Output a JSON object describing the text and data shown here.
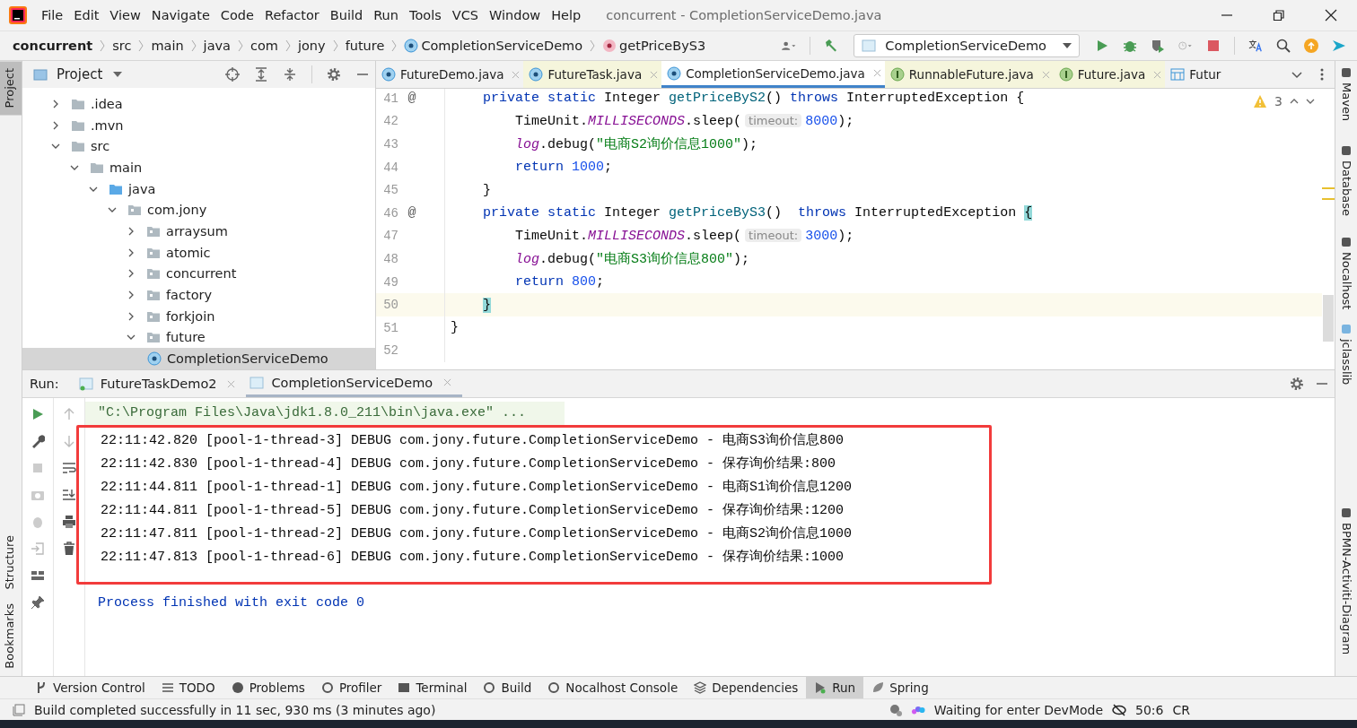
{
  "menu_bar": {
    "items": [
      "File",
      "Edit",
      "View",
      "Navigate",
      "Code",
      "Refactor",
      "Build",
      "Run",
      "Tools",
      "VCS",
      "Window",
      "Help"
    ],
    "title": "concurrent - CompletionServiceDemo.java"
  },
  "breadcrumb": [
    {
      "label": "concurrent",
      "kind": "project"
    },
    {
      "label": "src",
      "kind": "folder"
    },
    {
      "label": "main",
      "kind": "folder"
    },
    {
      "label": "java",
      "kind": "folder"
    },
    {
      "label": "com",
      "kind": "folder"
    },
    {
      "label": "jony",
      "kind": "folder"
    },
    {
      "label": "future",
      "kind": "folder"
    },
    {
      "label": "CompletionServiceDemo",
      "kind": "class"
    },
    {
      "label": "getPriceByS3",
      "kind": "method"
    }
  ],
  "run_config": {
    "label": "CompletionServiceDemo"
  },
  "left_strip_top": [
    {
      "label": "Project",
      "selected": true
    }
  ],
  "left_strip_bottom": [
    {
      "label": "Structure",
      "selected": false
    },
    {
      "label": "Bookmarks",
      "selected": false
    }
  ],
  "right_strip": [
    {
      "label": "Maven",
      "kind": "maven"
    },
    {
      "label": "Database",
      "kind": "database"
    },
    {
      "label": "Nocalhost",
      "kind": "nocalhost"
    },
    {
      "label": "jclasslib",
      "kind": "jclasslib"
    },
    {
      "label": "BPMN-Activiti-Diagram",
      "kind": "bpmn"
    }
  ],
  "project_panel": {
    "title": "Project",
    "tree": [
      {
        "label": ".idea",
        "kind": "folder",
        "expanded": false,
        "selected": false
      },
      {
        "label": ".mvn",
        "kind": "folder",
        "expanded": false,
        "selected": false
      },
      {
        "label": "src",
        "kind": "folder",
        "expanded": true,
        "selected": false,
        "children": [
          {
            "label": "main",
            "kind": "folder",
            "expanded": true,
            "selected": false,
            "children": [
              {
                "label": "java",
                "kind": "source",
                "expanded": true,
                "selected": false,
                "children": [
                  {
                    "label": "com.jony",
                    "kind": "package",
                    "expanded": true,
                    "selected": false,
                    "children": [
                      {
                        "label": "arraysum",
                        "kind": "package",
                        "expanded": false,
                        "selected": false
                      },
                      {
                        "label": "atomic",
                        "kind": "package",
                        "expanded": false,
                        "selected": false
                      },
                      {
                        "label": "concurrent",
                        "kind": "package",
                        "expanded": false,
                        "selected": false
                      },
                      {
                        "label": "factory",
                        "kind": "package",
                        "expanded": false,
                        "selected": false
                      },
                      {
                        "label": "forkjoin",
                        "kind": "package",
                        "expanded": false,
                        "selected": false
                      },
                      {
                        "label": "future",
                        "kind": "package",
                        "expanded": true,
                        "selected": false,
                        "children": [
                          {
                            "label": "CompletionServiceDemo",
                            "kind": "class",
                            "selected": true
                          }
                        ]
                      }
                    ]
                  }
                ]
              }
            ]
          }
        ]
      }
    ]
  },
  "editor_tabs": [
    {
      "label": "FutureDemo.java",
      "kind": "class",
      "library": false,
      "selected": false,
      "closable": true
    },
    {
      "label": "FutureTask.java",
      "kind": "class",
      "library": true,
      "selected": false,
      "closable": true
    },
    {
      "label": "CompletionServiceDemo.java",
      "kind": "class",
      "library": false,
      "selected": true,
      "closable": true
    },
    {
      "label": "RunnableFuture.java",
      "kind": "interface",
      "library": true,
      "selected": false,
      "closable": true
    },
    {
      "label": "Future.java",
      "kind": "interface",
      "library": true,
      "selected": false,
      "closable": true
    },
    {
      "label": "Futur",
      "kind": "diagram",
      "library": false,
      "selected": false,
      "closable": false
    }
  ],
  "editor": {
    "warnings": "3",
    "lines": [
      {
        "number": "41",
        "marker": "@",
        "current": false,
        "tokens": [
          {
            "text": "    private static ",
            "kind": "keyword"
          },
          {
            "text": "Integer ",
            "kind": "plain"
          },
          {
            "text": "getPriceByS2",
            "kind": "method"
          },
          {
            "text": "() ",
            "kind": "plain"
          },
          {
            "text": "throws ",
            "kind": "keyword"
          },
          {
            "text": "InterruptedException {",
            "kind": "plain"
          }
        ]
      },
      {
        "number": "42",
        "current": false,
        "tokens": [
          {
            "text": "        TimeUnit.",
            "kind": "plain"
          },
          {
            "text": "MILLISECONDS",
            "kind": "field"
          },
          {
            "text": ".sleep(",
            "kind": "plain"
          },
          {
            "text": "timeout:",
            "kind": "hint"
          },
          {
            "text": "8000",
            "kind": "number"
          },
          {
            "text": ");",
            "kind": "plain"
          }
        ]
      },
      {
        "number": "43",
        "current": false,
        "tokens": [
          {
            "text": "        log",
            "kind": "field"
          },
          {
            "text": ".debug(",
            "kind": "plain"
          },
          {
            "text": "\"电商S2询价信息1000\"",
            "kind": "string"
          },
          {
            "text": ");",
            "kind": "plain"
          }
        ]
      },
      {
        "number": "44",
        "current": false,
        "tokens": [
          {
            "text": "        return ",
            "kind": "keyword"
          },
          {
            "text": "1000",
            "kind": "number"
          },
          {
            "text": ";",
            "kind": "plain"
          }
        ]
      },
      {
        "number": "45",
        "current": false,
        "tokens": [
          {
            "text": "    }",
            "kind": "plain"
          }
        ]
      },
      {
        "number": "46",
        "marker": "@",
        "current": false,
        "tokens": [
          {
            "text": "    private static ",
            "kind": "keyword"
          },
          {
            "text": "Integer ",
            "kind": "plain"
          },
          {
            "text": "getPriceByS3",
            "kind": "method"
          },
          {
            "text": "()  ",
            "kind": "plain"
          },
          {
            "text": "throws ",
            "kind": "keyword"
          },
          {
            "text": "InterruptedException ",
            "kind": "plain"
          },
          {
            "text": "{",
            "kind": "brace"
          }
        ]
      },
      {
        "number": "47",
        "current": false,
        "tokens": [
          {
            "text": "        TimeUnit.",
            "kind": "plain"
          },
          {
            "text": "MILLISECONDS",
            "kind": "field"
          },
          {
            "text": ".sleep(",
            "kind": "plain"
          },
          {
            "text": "timeout:",
            "kind": "hint"
          },
          {
            "text": "3000",
            "kind": "number"
          },
          {
            "text": ");",
            "kind": "plain"
          }
        ]
      },
      {
        "number": "48",
        "current": false,
        "tokens": [
          {
            "text": "        log",
            "kind": "field"
          },
          {
            "text": ".debug(",
            "kind": "plain"
          },
          {
            "text": "\"电商S3询价信息800\"",
            "kind": "string"
          },
          {
            "text": ");",
            "kind": "plain"
          }
        ]
      },
      {
        "number": "49",
        "current": false,
        "tokens": [
          {
            "text": "        return ",
            "kind": "keyword"
          },
          {
            "text": "800",
            "kind": "number"
          },
          {
            "text": ";",
            "kind": "plain"
          }
        ]
      },
      {
        "number": "50",
        "current": true,
        "tokens": [
          {
            "text": "    }",
            "kind": "brace"
          }
        ]
      },
      {
        "number": "51",
        "current": false,
        "tokens": [
          {
            "text": "}",
            "kind": "plain"
          }
        ]
      },
      {
        "number": "52",
        "current": false
      }
    ]
  },
  "run_panel": {
    "label": "Run:",
    "tabs": [
      {
        "label": "FutureTaskDemo2",
        "selected": false
      },
      {
        "label": "CompletionServiceDemo",
        "selected": true
      }
    ],
    "command": "\"C:\\Program Files\\Java\\jdk1.8.0_211\\bin\\java.exe\" ...",
    "log_highlighted": true,
    "log_lines": [
      "22:11:42.820 [pool-1-thread-3] DEBUG com.jony.future.CompletionServiceDemo - 电商S3询价信息800",
      "22:11:42.830 [pool-1-thread-4] DEBUG com.jony.future.CompletionServiceDemo - 保存询价结果:800",
      "22:11:44.811 [pool-1-thread-1] DEBUG com.jony.future.CompletionServiceDemo - 电商S1询价信息1200",
      "22:11:44.811 [pool-1-thread-5] DEBUG com.jony.future.CompletionServiceDemo - 保存询价结果:1200",
      "22:11:47.811 [pool-1-thread-2] DEBUG com.jony.future.CompletionServiceDemo - 电商S2询价信息1000",
      "22:11:47.813 [pool-1-thread-6] DEBUG com.jony.future.CompletionServiceDemo - 保存询价结果:1000"
    ],
    "exit_message": "Process finished with exit code 0"
  },
  "tool_tabs": [
    {
      "label": "Version Control",
      "kind": "vcs",
      "selected": false
    },
    {
      "label": "TODO",
      "kind": "todo",
      "selected": false
    },
    {
      "label": "Problems",
      "kind": "problems",
      "selected": false
    },
    {
      "label": "Profiler",
      "kind": "profiler",
      "selected": false
    },
    {
      "label": "Terminal",
      "kind": "terminal",
      "selected": false
    },
    {
      "label": "Build",
      "kind": "build",
      "selected": false
    },
    {
      "label": "Nocalhost Console",
      "kind": "nocalhost",
      "selected": false
    },
    {
      "label": "Dependencies",
      "kind": "dependencies",
      "selected": false
    },
    {
      "label": "Run",
      "kind": "run",
      "selected": true
    },
    {
      "label": "Spring",
      "kind": "spring",
      "selected": false
    }
  ],
  "status_bar": {
    "message": "Build completed successfully in 11 sec, 930 ms (3 minutes ago)",
    "devmode": "Waiting for enter DevMode",
    "position": "50:6",
    "line_separator": "CR"
  }
}
